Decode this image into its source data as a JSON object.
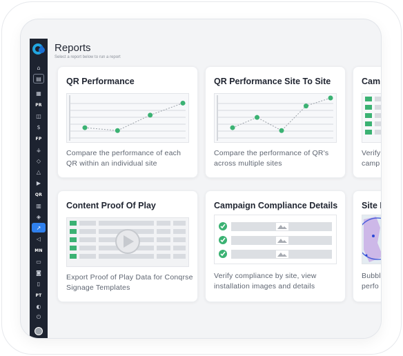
{
  "header": {
    "title": "Reports",
    "subtitle": "Select a report below to run a report"
  },
  "sidebar": {
    "sections": [
      "PR",
      "FP",
      "QR",
      "MN",
      "PT"
    ],
    "active_icon": "chart-icon"
  },
  "cards": [
    {
      "title": "QR Performance",
      "description": "Compare the performance of each QR within an individual site",
      "preview": "line-chart",
      "points": [
        18,
        13,
        40,
        61
      ]
    },
    {
      "title": "QR Performance Site To Site",
      "description": "Compare the performance of QR's across multiple sites",
      "preview": "line-chart",
      "points": [
        18,
        36,
        13,
        56,
        70
      ]
    },
    {
      "title": "Cam",
      "description": "Verify camp",
      "preview": "table-list"
    },
    {
      "title": "Content Proof Of Play",
      "description": "Export Proof of Play Data for Conqrse Signage Templates",
      "preview": "video-table"
    },
    {
      "title": "Campaign Compliance Details",
      "description": "Verify compliance by site, view installation images and details",
      "preview": "checklist-images"
    },
    {
      "title": "Site I",
      "description": "Bubbl perfo",
      "preview": "map"
    }
  ],
  "colors": {
    "accent_green": "#3bb273",
    "sidebar_bg": "#1d2330",
    "active_blue": "#2f80ed",
    "map_circle": "#2a47d6"
  }
}
